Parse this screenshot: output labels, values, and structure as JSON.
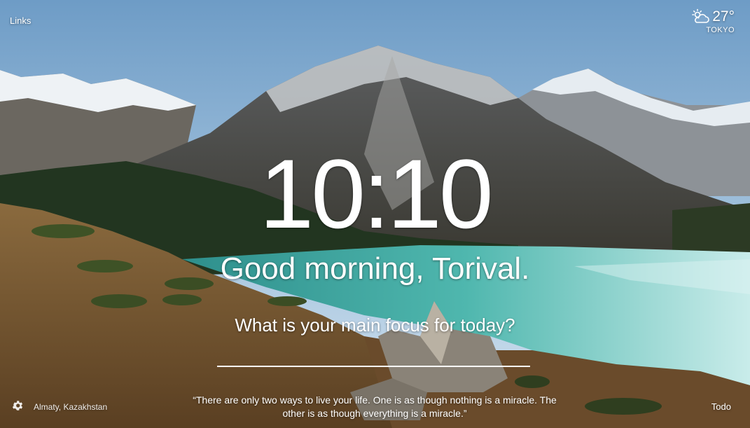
{
  "header": {
    "links_label": "Links"
  },
  "weather": {
    "temperature": "27°",
    "location": "TOKYO",
    "icon": "partly-cloudy-day-icon"
  },
  "main": {
    "time": "10:10",
    "greeting": "Good morning, Torival.",
    "focus_prompt": "What is your main focus for today?",
    "focus_value": ""
  },
  "footer": {
    "settings_icon": "gear-icon",
    "photo_location": "Almaty, Kazakhstan",
    "quote": "“There are only two ways to live your life. One is as though nothing is a miracle. The other is as though everything is a miracle.”",
    "todo_label": "Todo"
  },
  "colors": {
    "text": "#ffffff",
    "lake": "#4fb5ad",
    "sky": "#8fb6d8"
  }
}
